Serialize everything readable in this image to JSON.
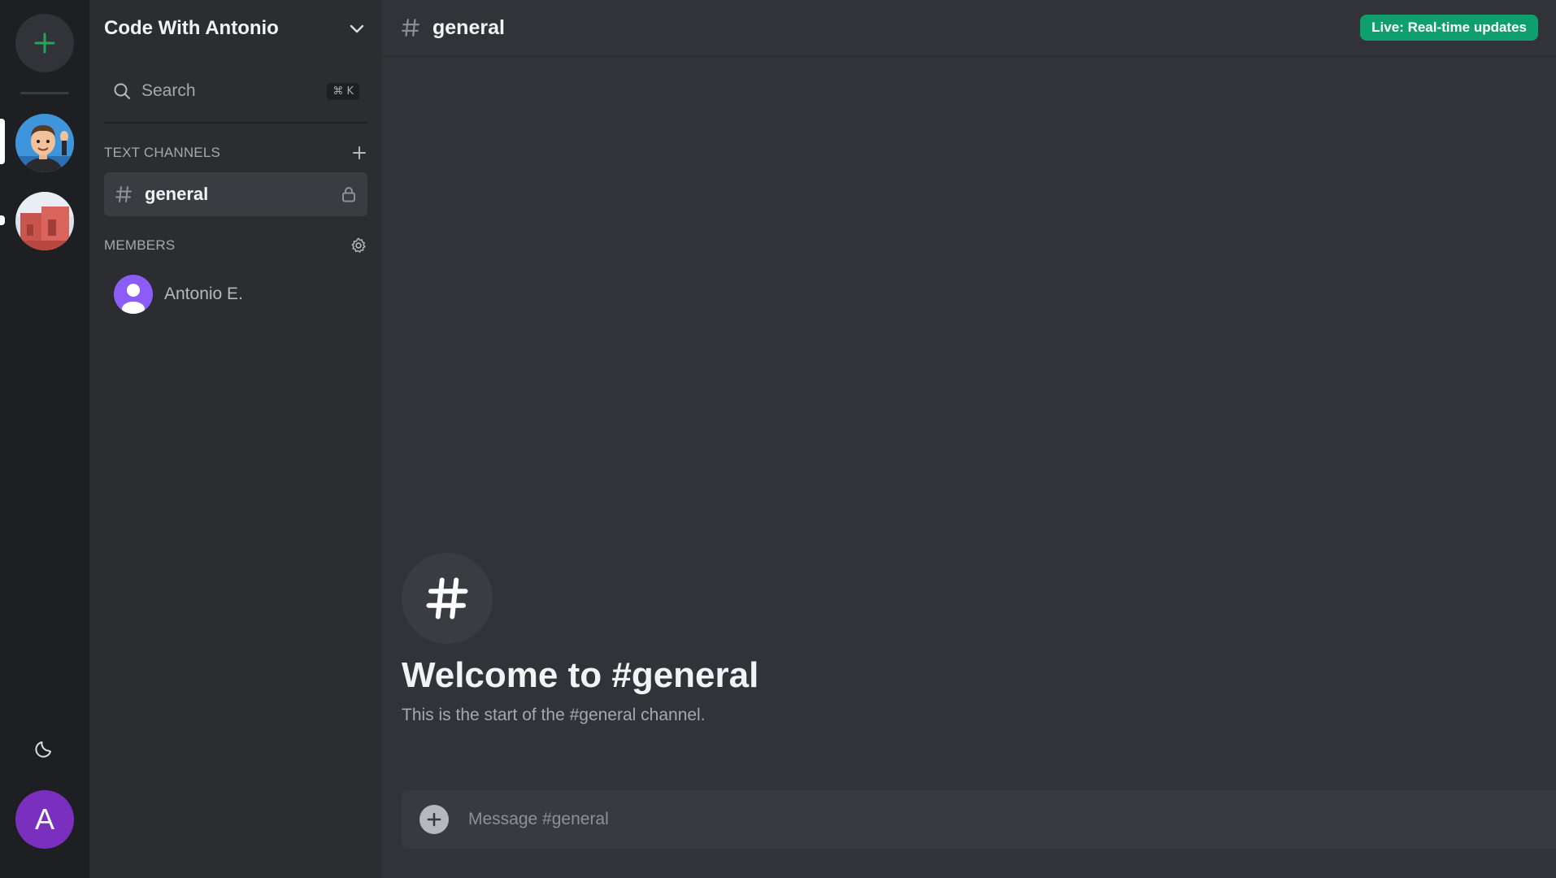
{
  "rail": {
    "add_icon": "plus-icon",
    "servers": [
      {
        "name": "code-with-antonio-server",
        "active": true
      },
      {
        "name": "second-server",
        "active": false
      }
    ],
    "theme_icon": "moon-icon",
    "user_initial": "A"
  },
  "sidebar": {
    "server_name": "Code With Antonio",
    "search_label": "Search",
    "search_shortcut": "⌘ K",
    "text_channels_title": "TEXT CHANNELS",
    "channels": [
      {
        "name": "general",
        "icon": "hash-icon",
        "locked": true
      }
    ],
    "members_title": "MEMBERS",
    "members": [
      {
        "name": "Antonio E."
      }
    ]
  },
  "header": {
    "channel_name": "general",
    "live_badge": "Live: Real-time updates"
  },
  "welcome": {
    "title": "Welcome to #general",
    "subtitle": "This is the start of the #general channel."
  },
  "composer": {
    "placeholder": "Message #general"
  },
  "colors": {
    "accent_green": "#0f9e6e",
    "add_green": "#23a55a",
    "avatar_purple": "#7b2fbf",
    "member_purple": "#8b5cf6"
  }
}
